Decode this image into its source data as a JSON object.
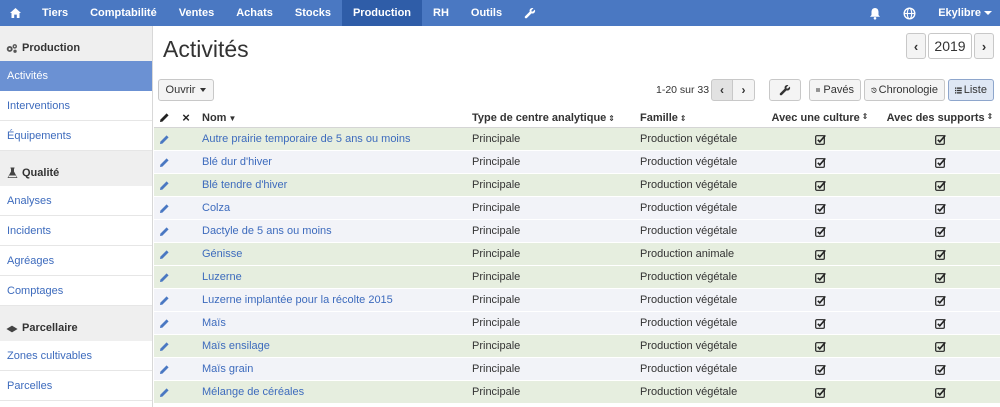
{
  "topbar": {
    "home_icon": "home-icon",
    "items": [
      {
        "label": "Tiers",
        "active": false
      },
      {
        "label": "Comptabilité",
        "active": false
      },
      {
        "label": "Ventes",
        "active": false
      },
      {
        "label": "Achats",
        "active": false
      },
      {
        "label": "Stocks",
        "active": false
      },
      {
        "label": "Production",
        "active": true
      },
      {
        "label": "RH",
        "active": false
      },
      {
        "label": "Outils",
        "active": false
      }
    ],
    "wrench_icon": "wrench-icon",
    "bell_icon": "bell-icon",
    "globe_icon": "globe-icon",
    "user_label": "Ekylibre",
    "colors": {
      "bar": "#4a78c2",
      "active": "#2f5da8"
    }
  },
  "sidebar": {
    "sections": [
      {
        "title": "Production",
        "icon": "gears-icon",
        "items": [
          {
            "label": "Activités",
            "active": true
          },
          {
            "label": "Interventions",
            "active": false
          },
          {
            "label": "Équipements",
            "active": false
          }
        ]
      },
      {
        "title": "Qualité",
        "icon": "flask-icon",
        "items": [
          {
            "label": "Analyses",
            "active": false
          },
          {
            "label": "Incidents",
            "active": false
          },
          {
            "label": "Agréages",
            "active": false
          },
          {
            "label": "Comptages",
            "active": false
          }
        ]
      },
      {
        "title": "Parcellaire",
        "icon": "map-icon",
        "items": [
          {
            "label": "Zones cultivables",
            "active": false
          },
          {
            "label": "Parcelles",
            "active": false
          }
        ]
      }
    ]
  },
  "main": {
    "title": "Activités",
    "year": "2019",
    "toolbar": {
      "open_label": "Ouvrir",
      "pager_text": "1-20 sur 33",
      "view_blocks": "Pavés",
      "view_timeline": "Chronologie",
      "view_list": "Liste"
    },
    "table": {
      "headers": {
        "name": "Nom",
        "type": "Type de centre analytique",
        "family": "Famille",
        "culture": "Avec une culture",
        "supports": "Avec des supports"
      },
      "rows": [
        {
          "name": "Autre prairie temporaire de 5 ans ou moins",
          "type": "Principale",
          "family": "Production végétale",
          "culture": true,
          "supports": true,
          "shade": "g"
        },
        {
          "name": "Blé dur d'hiver",
          "type": "Principale",
          "family": "Production végétale",
          "culture": true,
          "supports": true,
          "shade": "b"
        },
        {
          "name": "Blé tendre d'hiver",
          "type": "Principale",
          "family": "Production végétale",
          "culture": true,
          "supports": true,
          "shade": "g"
        },
        {
          "name": "Colza",
          "type": "Principale",
          "family": "Production végétale",
          "culture": true,
          "supports": true,
          "shade": "b"
        },
        {
          "name": "Dactyle de 5 ans ou moins",
          "type": "Principale",
          "family": "Production végétale",
          "culture": true,
          "supports": true,
          "shade": "b"
        },
        {
          "name": "Génisse",
          "type": "Principale",
          "family": "Production animale",
          "culture": true,
          "supports": true,
          "shade": "g"
        },
        {
          "name": "Luzerne",
          "type": "Principale",
          "family": "Production végétale",
          "culture": true,
          "supports": true,
          "shade": "g"
        },
        {
          "name": "Luzerne implantée pour la récolte 2015",
          "type": "Principale",
          "family": "Production végétale",
          "culture": true,
          "supports": true,
          "shade": "b"
        },
        {
          "name": "Maïs",
          "type": "Principale",
          "family": "Production végétale",
          "culture": true,
          "supports": true,
          "shade": "b"
        },
        {
          "name": "Maïs ensilage",
          "type": "Principale",
          "family": "Production végétale",
          "culture": true,
          "supports": true,
          "shade": "g"
        },
        {
          "name": "Maïs grain",
          "type": "Principale",
          "family": "Production végétale",
          "culture": true,
          "supports": true,
          "shade": "b"
        },
        {
          "name": "Mélange de céréales",
          "type": "Principale",
          "family": "Production végétale",
          "culture": true,
          "supports": true,
          "shade": "g"
        }
      ]
    }
  }
}
